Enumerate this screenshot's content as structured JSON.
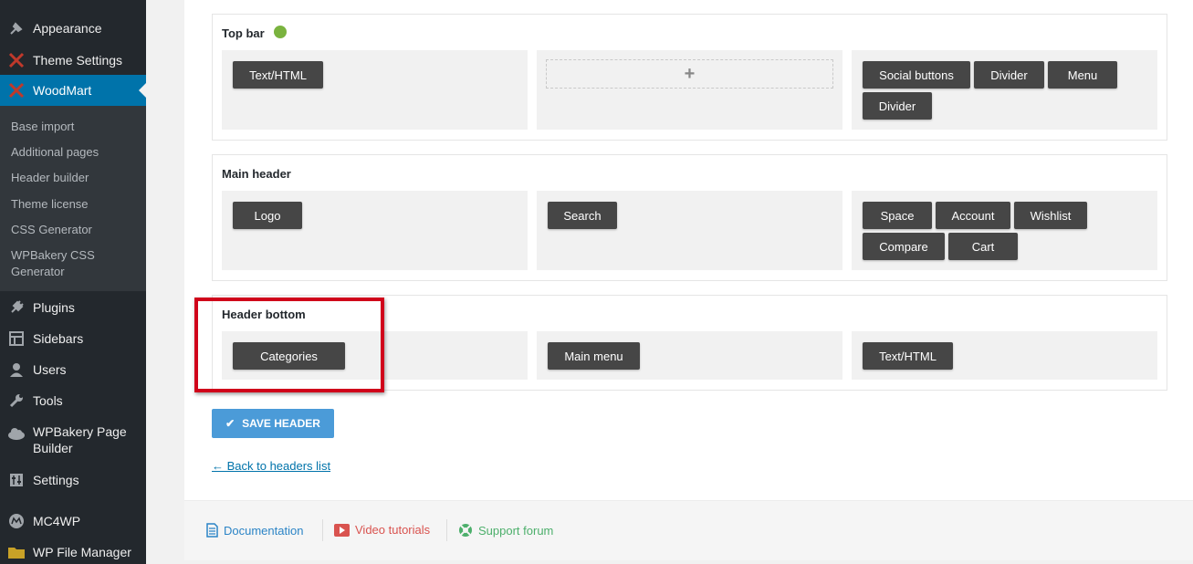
{
  "sidebar": {
    "top_items": [
      {
        "label": "Appearance",
        "icon": "brush-icon"
      },
      {
        "label": "Theme Settings",
        "icon": "woodmart-x-icon"
      },
      {
        "label": "WoodMart",
        "icon": "woodmart-x-icon"
      }
    ],
    "submenu": [
      "Base import",
      "Additional pages",
      "Header builder",
      "Theme license",
      "CSS Generator",
      "WPBakery CSS Generator"
    ],
    "bottom_items": [
      {
        "label": "Plugins",
        "icon": "plug-icon"
      },
      {
        "label": "Sidebars",
        "icon": "sidebars-icon"
      },
      {
        "label": "Users",
        "icon": "user-icon"
      },
      {
        "label": "Tools",
        "icon": "wrench-icon"
      },
      {
        "label": "WPBakery Page Builder",
        "icon": "cloud-icon"
      },
      {
        "label": "Settings",
        "icon": "sliders-icon"
      },
      {
        "label": "MC4WP",
        "icon": "mc4wp-icon"
      },
      {
        "label": "WP File Manager",
        "icon": "folder-icon"
      }
    ],
    "accent": "#0073aa"
  },
  "rows": {
    "top_bar": {
      "title": "Top bar",
      "status_color": "#7ab33f",
      "left": [
        "Text/HTML"
      ],
      "center_add": "+",
      "right": [
        "Social buttons",
        "Divider",
        "Menu",
        "Divider"
      ]
    },
    "main_header": {
      "title": "Main header",
      "left": [
        "Logo"
      ],
      "center": [
        "Search"
      ],
      "right": [
        "Space",
        "Account",
        "Wishlist",
        "Compare",
        "Cart"
      ]
    },
    "header_bottom": {
      "title": "Header bottom",
      "left": [
        "Categories"
      ],
      "center": [
        "Main menu"
      ],
      "right": [
        "Text/HTML"
      ]
    }
  },
  "actions": {
    "save_label": "SAVE HEADER",
    "back_label": "← Back to headers list"
  },
  "footer": {
    "documentation": "Documentation",
    "video": "Video tutorials",
    "support": "Support forum"
  }
}
